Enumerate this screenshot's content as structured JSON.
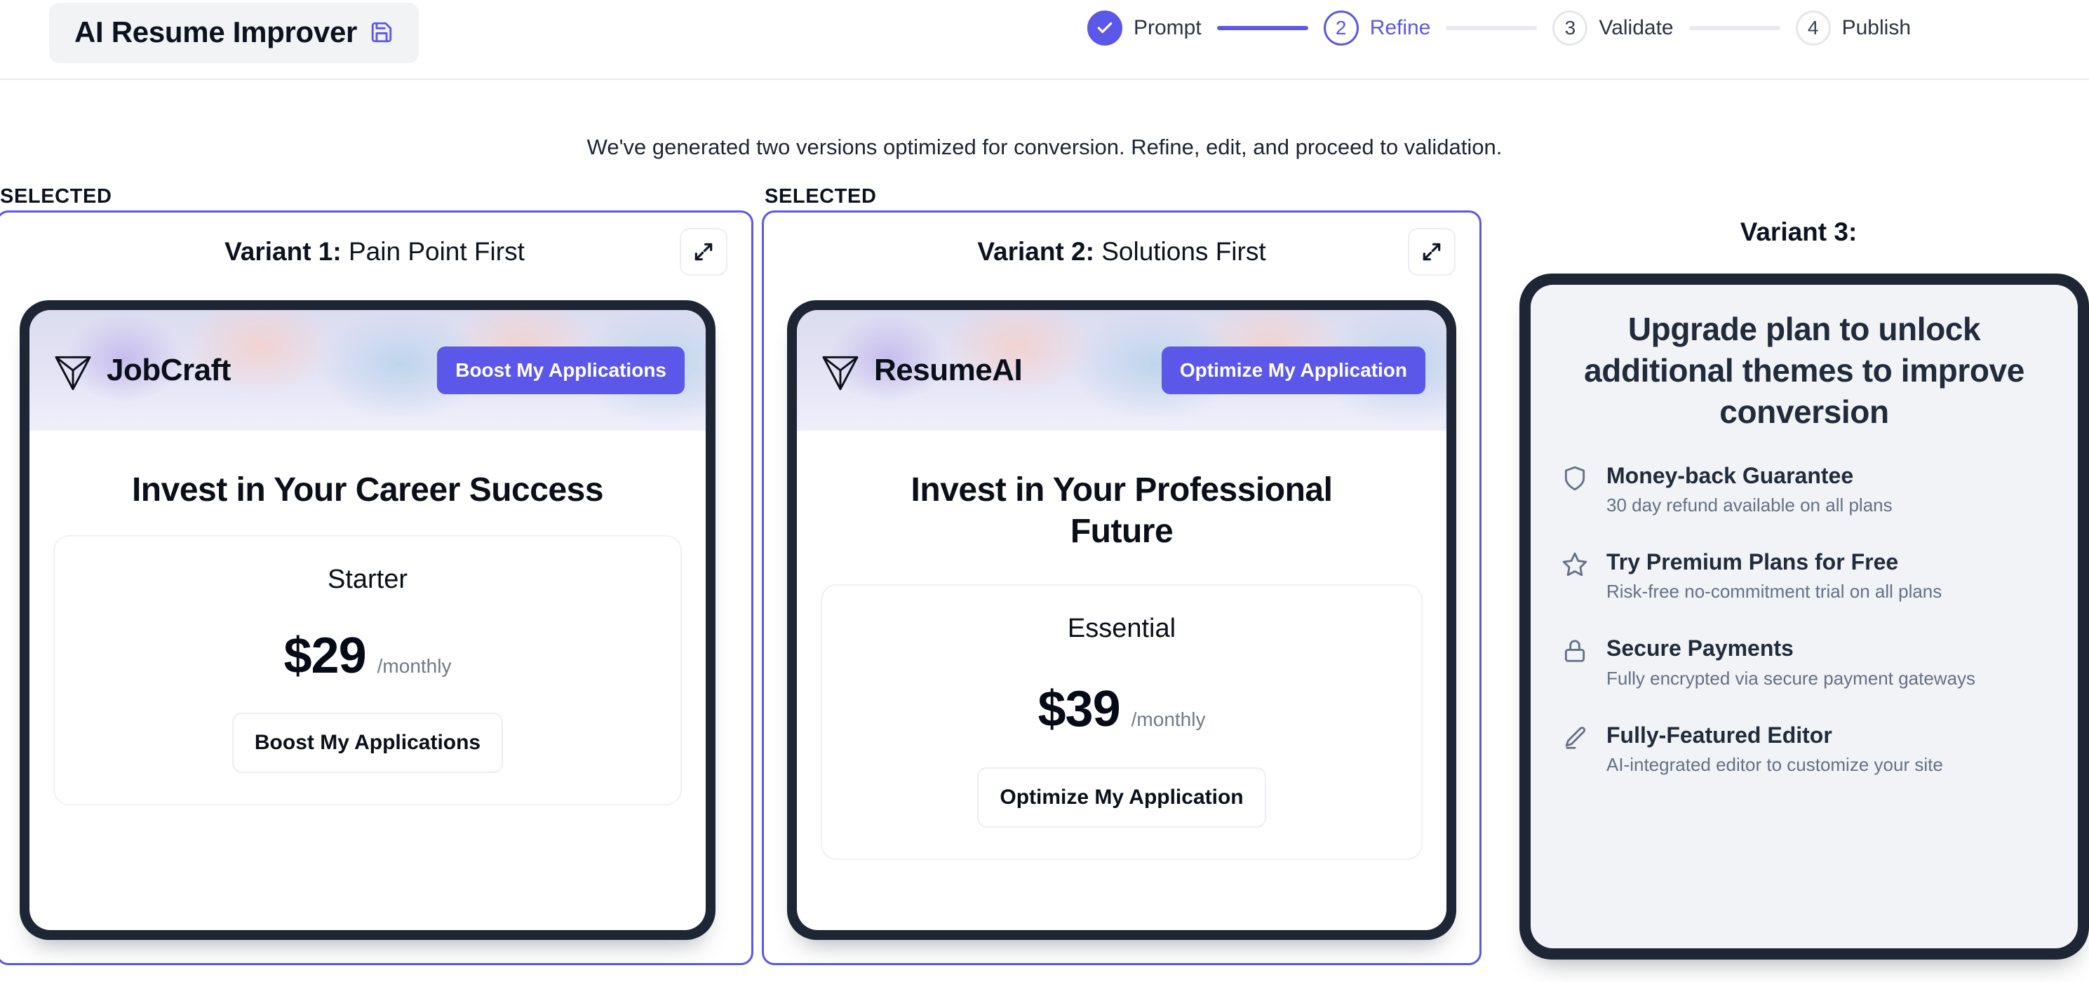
{
  "header": {
    "app_title": "AI Resume Improver",
    "save_icon": "save-icon",
    "steps": [
      {
        "num": "1",
        "label": "Prompt",
        "state": "done"
      },
      {
        "num": "2",
        "label": "Refine",
        "state": "active"
      },
      {
        "num": "3",
        "label": "Validate",
        "state": "todo"
      },
      {
        "num": "4",
        "label": "Publish",
        "state": "todo"
      }
    ]
  },
  "main": {
    "subtitle": "We've generated two versions optimized for conversion. Refine, edit, and proceed to validation.",
    "selected_badge": "SELECTED",
    "variants": [
      {
        "label_bold": "Variant 1:",
        "label_rest": " Pain Point First",
        "expand_icon": "expand-icon",
        "preview": {
          "brand": "JobCraft",
          "logo_icon": "triangle-logo-icon",
          "cta_top": "Boost My Applications",
          "hero": "Invest in Your Career Success",
          "plan_name": "Starter",
          "price": "$29",
          "period": "/monthly",
          "plan_cta": "Boost My Applications"
        }
      },
      {
        "label_bold": "Variant 2:",
        "label_rest": " Solutions First",
        "expand_icon": "expand-icon",
        "preview": {
          "brand": "ResumeAI",
          "logo_icon": "triangle-logo-icon",
          "cta_top": "Optimize My Application",
          "hero": "Invest in Your Professional Future",
          "plan_name": "Essential",
          "price": "$39",
          "period": "/monthly",
          "plan_cta": "Optimize My Application"
        }
      }
    ],
    "variant3": {
      "label": "Variant 3:",
      "upgrade_headline": "Upgrade plan to unlock additional themes to improve conversion",
      "features": [
        {
          "icon": "shield-icon",
          "title": "Money-back Guarantee",
          "subtitle": "30 day refund available on all plans"
        },
        {
          "icon": "star-icon",
          "title": "Try Premium Plans for Free",
          "subtitle": "Risk-free no-commitment trial on all plans"
        },
        {
          "icon": "lock-icon",
          "title": "Secure Payments",
          "subtitle": "Fully encrypted via secure payment gateways"
        },
        {
          "icon": "pencil-icon",
          "title": "Fully-Featured Editor",
          "subtitle": "AI-integrated editor to customize your site"
        }
      ]
    }
  },
  "colors": {
    "accent": "#5b57e8",
    "dark": "#1e2535",
    "muted": "#667084"
  }
}
